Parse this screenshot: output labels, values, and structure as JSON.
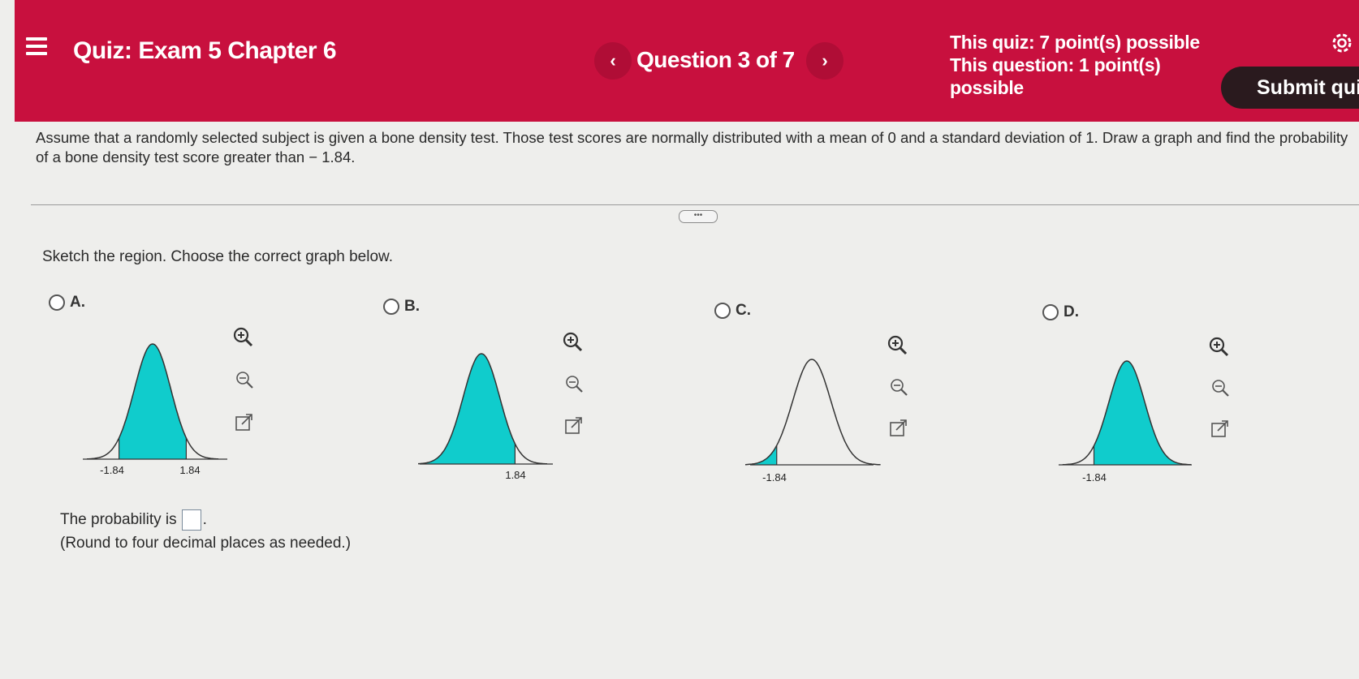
{
  "header": {
    "title": "Quiz: Exam 5 Chapter 6",
    "question_counter": "Question 3 of 7",
    "prev_label": "‹",
    "next_label": "›",
    "quiz_points": "This quiz: 7 point(s) possible",
    "question_points_line1": "This question: 1 point(s)",
    "question_points_line2": "possible",
    "submit_label": "Submit quiz"
  },
  "question": {
    "text": "Assume that a randomly selected subject is given a bone density test. Those test scores are normally distributed with a mean of 0 and a standard deviation of 1. Draw a graph and find the probability of a bone density test score greater than − 1.84."
  },
  "divider_handle_label": "•••",
  "instruction": "Sketch the region. Choose the correct graph below.",
  "options": [
    {
      "letter": "A.",
      "labels": [
        "-1.84",
        "1.84"
      ],
      "shading": "between"
    },
    {
      "letter": "B.",
      "labels": [
        "1.84"
      ],
      "shading": "left"
    },
    {
      "letter": "C.",
      "labels": [
        "-1.84"
      ],
      "shading": "left"
    },
    {
      "letter": "D.",
      "labels": [
        "-1.84"
      ],
      "shading": "right"
    }
  ],
  "icons": {
    "zoom_in": "zoom-in-icon",
    "zoom_out": "zoom-out-icon",
    "open_window": "open-window-icon"
  },
  "colors": {
    "header_bg": "#c8103e",
    "shade": "#10cccc",
    "submit_bg": "#2a1a1e"
  },
  "answer": {
    "prefix": "The probability is",
    "suffix": ".",
    "note": "(Round to four decimal places as needed.)"
  }
}
